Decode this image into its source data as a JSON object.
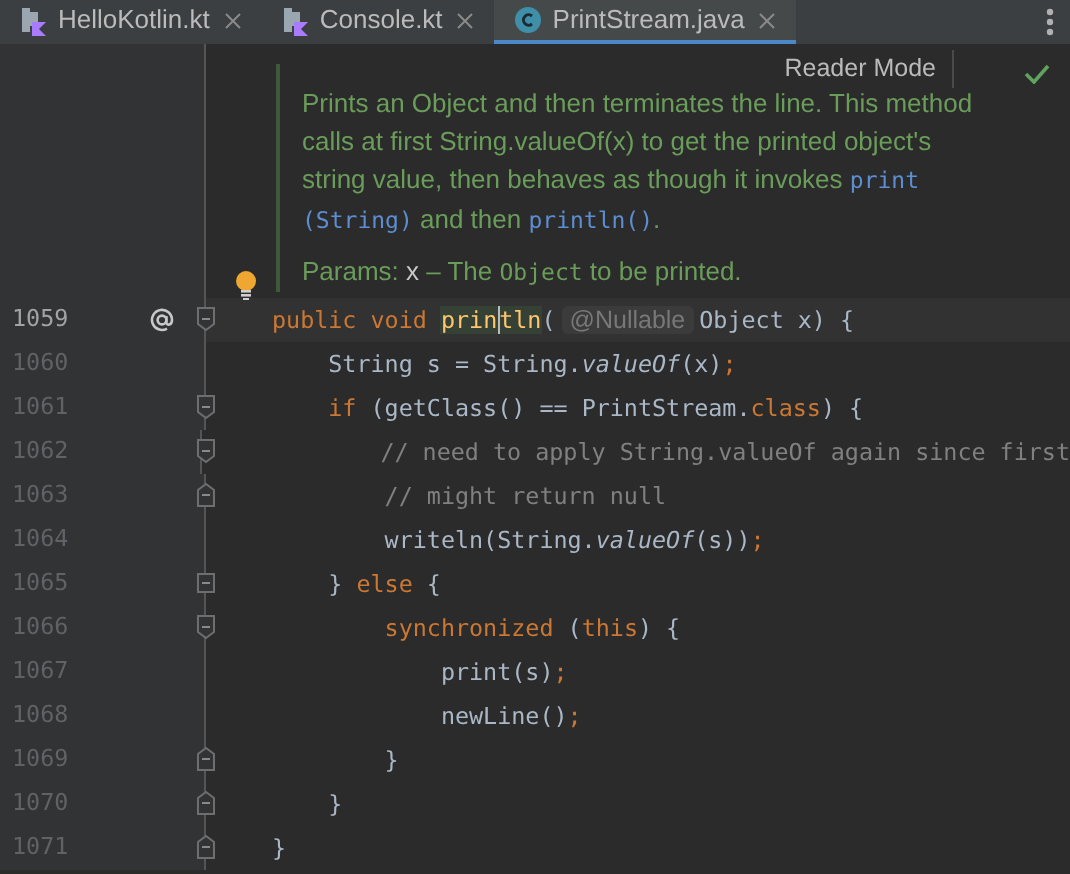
{
  "tabs": [
    {
      "label": "HelloKotlin.kt",
      "kind": "kotlin",
      "selected": false
    },
    {
      "label": "Console.kt",
      "kind": "kotlin",
      "selected": false
    },
    {
      "label": "PrintStream.java",
      "kind": "java",
      "selected": true
    }
  ],
  "reader_mode": {
    "label": "Reader Mode"
  },
  "doc": {
    "paragraph": [
      {
        "text": "Prints an Object and then terminates the line. This method calls at first String.valueOf(x) to get the printed object's string value, then behaves as though it invokes ",
        "kind": "prose"
      },
      {
        "text": "print (String)",
        "kind": "code"
      },
      {
        "text": " and then ",
        "kind": "prose"
      },
      {
        "text": "println()",
        "kind": "code"
      },
      {
        "text": ".",
        "kind": "prose"
      }
    ],
    "params": [
      {
        "text": "Params: ",
        "kind": "prose"
      },
      {
        "text": "x",
        "kind": "name"
      },
      {
        "text": " – The ",
        "kind": "prose"
      },
      {
        "text": "Object",
        "kind": "code"
      },
      {
        "text": " to be printed.",
        "kind": "prose"
      }
    ]
  },
  "lines": [
    {
      "number": "1059",
      "current": true,
      "override": true,
      "fold_start": true,
      "fold_end": false,
      "tokens": [
        {
          "text": "public void ",
          "kind": "keyword"
        },
        {
          "text": "prin",
          "kind": "declaration",
          "highlighted": true,
          "caret": false
        },
        {
          "text": "tln",
          "kind": "declaration",
          "highlighted": true,
          "caret": true
        },
        {
          "text": "(",
          "kind": "plain"
        },
        {
          "text": "@Nullable",
          "kind": "hint"
        },
        {
          "text": "Object x) {",
          "kind": "plain"
        }
      ]
    },
    {
      "number": "1060",
      "current": false,
      "override": false,
      "fold_start": false,
      "fold_end": false,
      "tokens": [
        {
          "text": "    String s = String.",
          "kind": "plain"
        },
        {
          "text": "valueOf",
          "kind": "static"
        },
        {
          "text": "(x)",
          "kind": "plain"
        },
        {
          "text": ";",
          "kind": "keyword"
        }
      ]
    },
    {
      "number": "1061",
      "current": false,
      "override": false,
      "fold_start": true,
      "fold_end": false,
      "tokens": [
        {
          "text": "    if ",
          "kind": "keyword"
        },
        {
          "text": "(getClass() == PrintStream.",
          "kind": "plain"
        },
        {
          "text": "class",
          "kind": "keyword"
        },
        {
          "text": ") {",
          "kind": "plain"
        }
      ]
    },
    {
      "number": "1062",
      "current": false,
      "override": false,
      "fold_start": true,
      "fold_end": false,
      "tokens": [
        {
          "text": "        // need to apply String.valueOf again since first",
          "kind": "comment"
        }
      ]
    },
    {
      "number": "1063",
      "current": false,
      "override": false,
      "fold_start": false,
      "fold_end": true,
      "tokens": [
        {
          "text": "        // might return null",
          "kind": "comment"
        }
      ]
    },
    {
      "number": "1064",
      "current": false,
      "override": false,
      "fold_start": false,
      "fold_end": false,
      "tokens": [
        {
          "text": "        writeln(String.",
          "kind": "plain"
        },
        {
          "text": "valueOf",
          "kind": "static"
        },
        {
          "text": "(s))",
          "kind": "plain"
        },
        {
          "text": ";",
          "kind": "keyword"
        }
      ]
    },
    {
      "number": "1065",
      "current": false,
      "override": false,
      "fold_start": true,
      "fold_end": true,
      "tokens": [
        {
          "text": "    } ",
          "kind": "plain"
        },
        {
          "text": "else ",
          "kind": "keyword"
        },
        {
          "text": "{",
          "kind": "plain"
        }
      ]
    },
    {
      "number": "1066",
      "current": false,
      "override": false,
      "fold_start": true,
      "fold_end": false,
      "tokens": [
        {
          "text": "        synchronized ",
          "kind": "keyword"
        },
        {
          "text": "(",
          "kind": "plain"
        },
        {
          "text": "this",
          "kind": "keyword"
        },
        {
          "text": ") {",
          "kind": "plain"
        }
      ]
    },
    {
      "number": "1067",
      "current": false,
      "override": false,
      "fold_start": false,
      "fold_end": false,
      "tokens": [
        {
          "text": "            print(s)",
          "kind": "plain"
        },
        {
          "text": ";",
          "kind": "keyword"
        }
      ]
    },
    {
      "number": "1068",
      "current": false,
      "override": false,
      "fold_start": false,
      "fold_end": false,
      "tokens": [
        {
          "text": "            newLine()",
          "kind": "plain"
        },
        {
          "text": ";",
          "kind": "keyword"
        }
      ]
    },
    {
      "number": "1069",
      "current": false,
      "override": false,
      "fold_start": false,
      "fold_end": true,
      "tokens": [
        {
          "text": "        }",
          "kind": "plain"
        }
      ]
    },
    {
      "number": "1070",
      "current": false,
      "override": false,
      "fold_start": false,
      "fold_end": true,
      "tokens": [
        {
          "text": "    }",
          "kind": "plain"
        }
      ]
    },
    {
      "number": "1071",
      "current": false,
      "override": false,
      "fold_start": false,
      "fold_end": true,
      "tokens": [
        {
          "text": "}",
          "kind": "plain"
        }
      ]
    }
  ]
}
